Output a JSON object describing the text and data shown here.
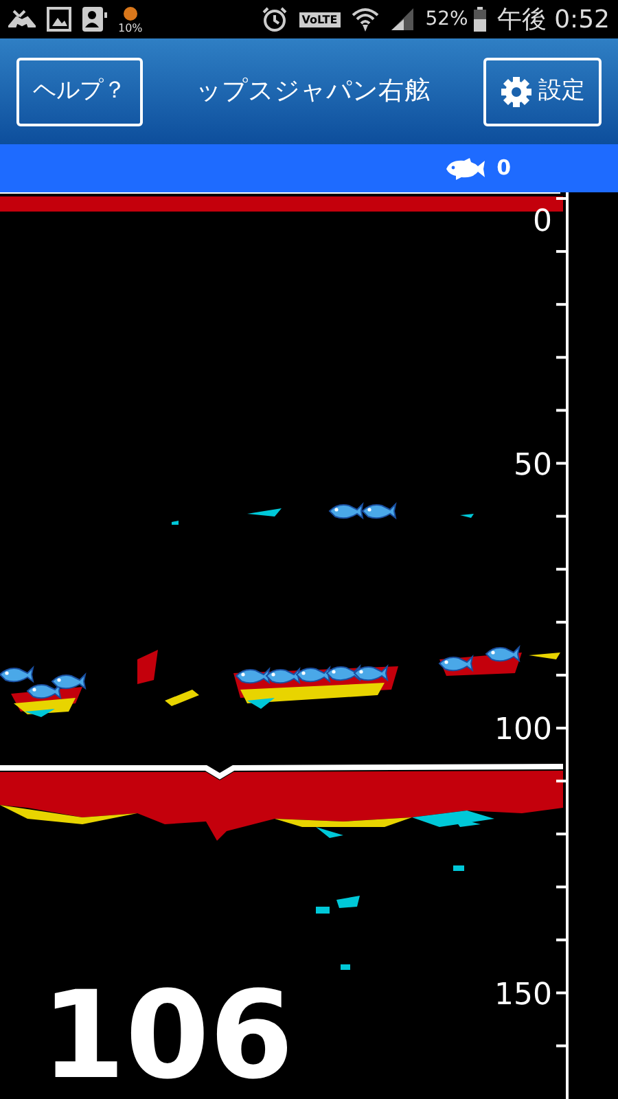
{
  "status_bar": {
    "notification_level": "10%",
    "network_badge": "VoLTE",
    "battery": "52%",
    "time": "午後 0:52"
  },
  "header": {
    "help_button": "ヘルプ？",
    "title": "ップスジャパン右舷",
    "settings_button": "設定"
  },
  "info_bar": {
    "fish_count": "0"
  },
  "sonar": {
    "depth_labels": [
      {
        "depth": "0"
      },
      {
        "depth": "50"
      },
      {
        "depth": "100"
      },
      {
        "depth": "150"
      }
    ],
    "depth_reading": "106"
  }
}
